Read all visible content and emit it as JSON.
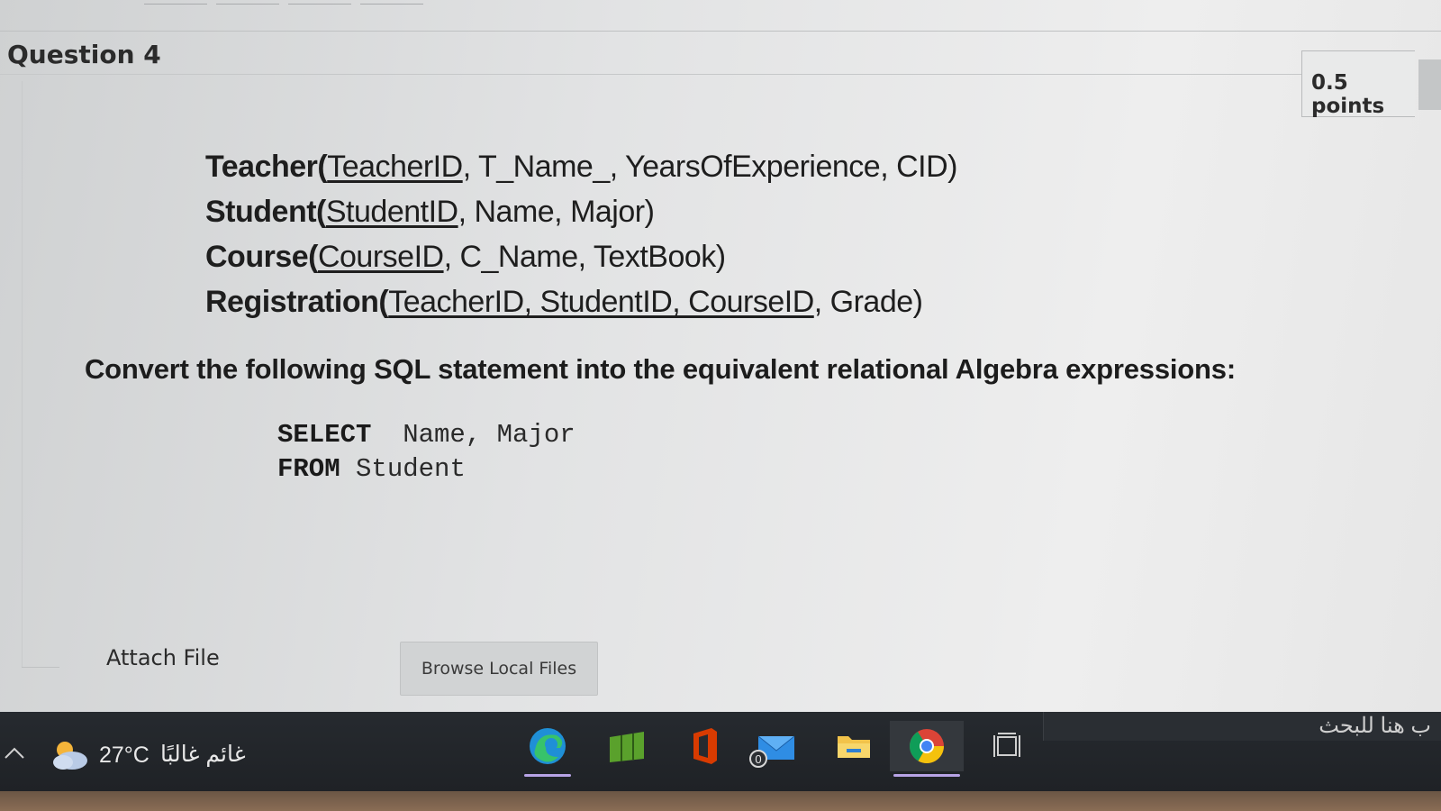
{
  "question": {
    "title": "Question 4",
    "points": "0.5 points"
  },
  "schema": [
    {
      "name": "Teacher",
      "open": "(",
      "keys": [
        "TeacherID"
      ],
      "rest": ", T_Name_, YearsOfExperience, CID)"
    },
    {
      "name": "Student",
      "open": "(",
      "keys": [
        "StudentID"
      ],
      "rest": ", Name, Major)"
    },
    {
      "name": "Course",
      "open": "(",
      "keys": [
        "CourseID"
      ],
      "rest": ", C_Name, TextBook)"
    },
    {
      "name": "Registration",
      "open": "(",
      "keys": [
        "TeacherID, StudentID, CourseID"
      ],
      "rest": ", Grade)"
    }
  ],
  "instruction": "Convert the following SQL statement into the equivalent relational Algebra expressions:",
  "sql": {
    "line1_keyword": "SELECT",
    "line1_rest": "  Name, Major",
    "line2_keyword": "FROM",
    "line2_rest": " Student"
  },
  "attach": {
    "label": "Attach File",
    "button": "Browse Local Files"
  },
  "taskbar": {
    "temperature": "27°C",
    "weather": "غائم غالبًا",
    "search": "ب هنا للبحث",
    "mail_badge": "0",
    "icons": [
      "edge-icon",
      "spreadsheet-icon",
      "office-icon",
      "mail-icon",
      "file-explorer-icon",
      "chrome-icon",
      "task-view-icon"
    ],
    "colors": {
      "edge": "#1f8fd6",
      "chrome_accent": "#b7a3e6",
      "office": "#d83b01"
    }
  }
}
